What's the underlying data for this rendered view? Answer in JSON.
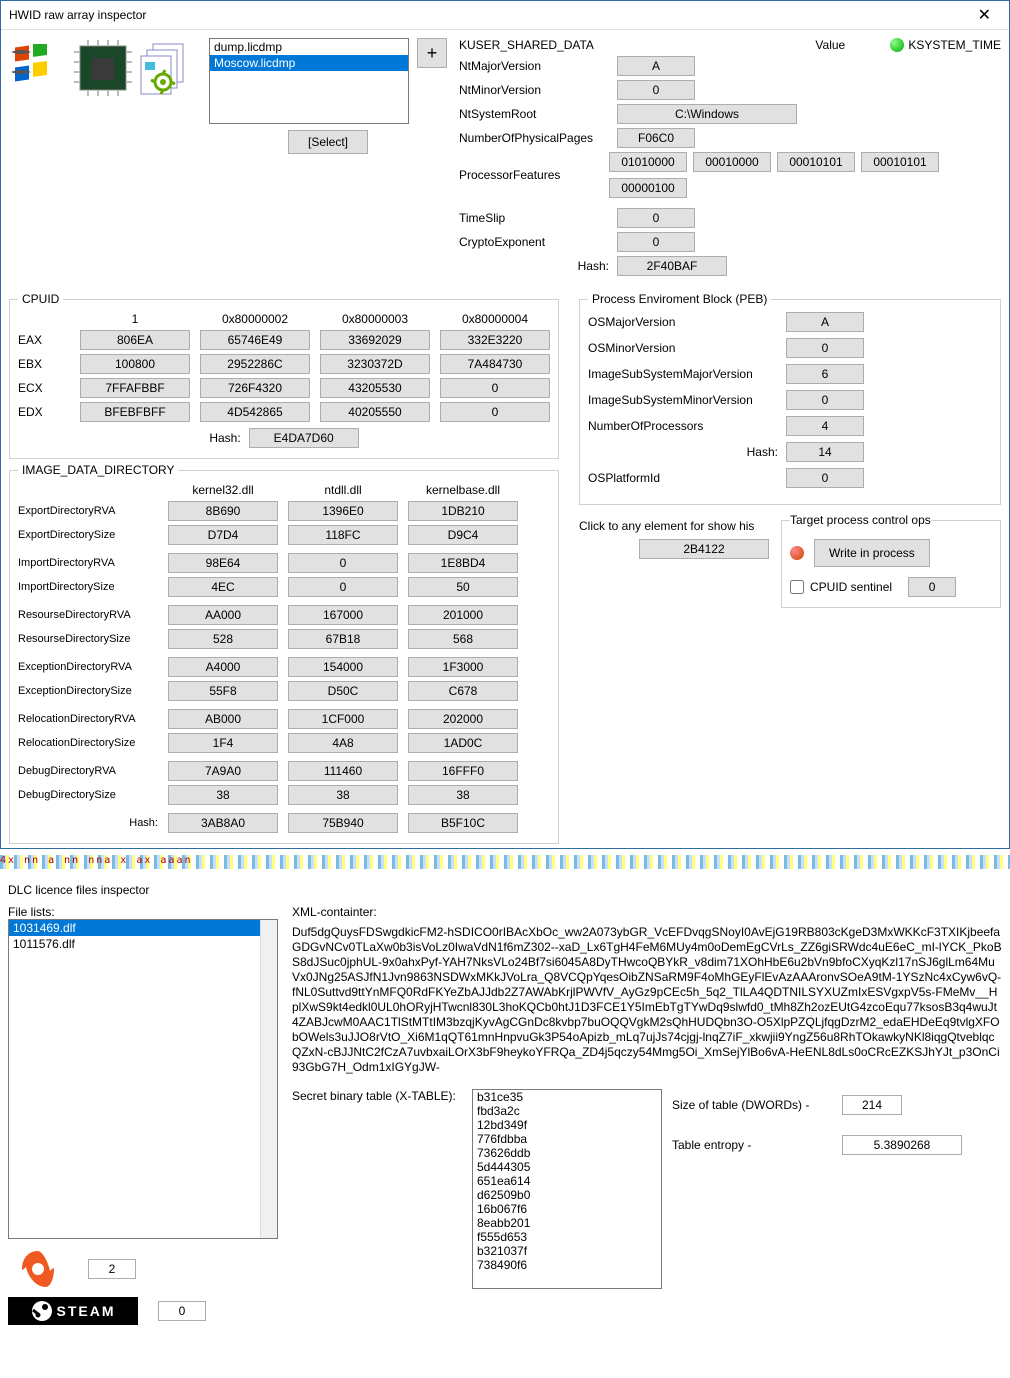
{
  "window1": {
    "title": "HWID raw array inspector",
    "filelist": [
      "dump.licdmp",
      "Moscow.licdmp"
    ],
    "selected_file_idx": 1,
    "plus_label": "+",
    "select_label": "[Select]",
    "ksd": {
      "header": "KUSER_SHARED_DATA",
      "value_header": "Value",
      "systime_label": "KSYSTEM_TIME",
      "rows": {
        "NtMajorVersion": "A",
        "NtMinorVersion": "0",
        "NtSystemRoot": "C:\\Windows",
        "NumberOfPhysicalPages": "F06C0"
      },
      "proc_features_label": "ProcessorFeatures",
      "proc_features": [
        "01010000",
        "00010000",
        "00010101",
        "00010101",
        "00000100"
      ],
      "time_slip_label": "TimeSlip",
      "time_slip": "0",
      "crypto_label": "CryptoExponent",
      "crypto": "0",
      "hash_label": "Hash:",
      "hash": "2F40BAF"
    }
  },
  "cpuid": {
    "legend": "CPUID",
    "cols": [
      "1",
      "0x80000002",
      "0x80000003",
      "0x80000004"
    ],
    "rows": [
      "EAX",
      "EBX",
      "ECX",
      "EDX"
    ],
    "vals": [
      [
        "806EA",
        "65746E49",
        "33692029",
        "332E3220"
      ],
      [
        "100800",
        "2952286C",
        "3230372D",
        "7A484730"
      ],
      [
        "7FFAFBBF",
        "726F4320",
        "43205530",
        "0"
      ],
      [
        "BFEBFBFF",
        "4D542865",
        "40205550",
        "0"
      ]
    ],
    "hash_label": "Hash:",
    "hash": "E4DA7D60"
  },
  "idd": {
    "legend": "IMAGE_DATA_DIRECTORY",
    "cols": [
      "kernel32.dll",
      "ntdll.dll",
      "kernelbase.dll"
    ],
    "rows": [
      "ExportDirectoryRVA",
      "ExportDirectorySize",
      "ImportDirectoryRVA",
      "ImportDirectorySize",
      "ResourseDirectoryRVA",
      "ResourseDirectorySize",
      "ExceptionDirectoryRVA",
      "ExceptionDirectorySize",
      "RelocationDirectoryRVA",
      "RelocationDirectorySize",
      "DebugDirectoryRVA",
      "DebugDirectorySize"
    ],
    "vals": [
      [
        "8B690",
        "1396E0",
        "1DB210"
      ],
      [
        "D7D4",
        "118FC",
        "D9C4"
      ],
      [
        "98E64",
        "0",
        "1E8BD4"
      ],
      [
        "4EC",
        "0",
        "50"
      ],
      [
        "AA000",
        "167000",
        "201000"
      ],
      [
        "528",
        "67B18",
        "568"
      ],
      [
        "A4000",
        "154000",
        "1F3000"
      ],
      [
        "55F8",
        "D50C",
        "C678"
      ],
      [
        "AB000",
        "1CF000",
        "202000"
      ],
      [
        "1F4",
        "4A8",
        "1AD0C"
      ],
      [
        "7A9A0",
        "111460",
        "16FFF0"
      ],
      [
        "38",
        "38",
        "38"
      ]
    ],
    "hash_label": "Hash:",
    "hash": [
      "3AB8A0",
      "75B940",
      "B5F10C"
    ]
  },
  "peb": {
    "legend": "Process Enviroment Block (PEB)",
    "rows": {
      "OSMajorVersion": "A",
      "OSMinorVersion": "0",
      "ImageSubSystemMajorVersion": "6",
      "ImageSubSystemMinorVersion": "0",
      "NumberOfProcessors": "4"
    },
    "hash_label": "Hash:",
    "hash": "14",
    "platform_label": "OSPlatformId",
    "platform": "0"
  },
  "click_label": "Click to any element for show his",
  "click_value": "2B4122",
  "tpcops": {
    "legend": "Target process control ops",
    "write_label": "Write in process",
    "sentinel_label": "CPUID sentinel",
    "sentinel_value": "0"
  },
  "garbage": "4x nn a   nn nna x     ax aaan",
  "window2": {
    "title": "DLC licence files inspector",
    "file_list_label": "File lists:",
    "files": [
      "1011576.dlf",
      "1031469.dlf"
    ],
    "selected_file_idx": 1,
    "origin_count": "2",
    "steam_text": "STEAM",
    "steam_count": "0",
    "xml_label": "XML-containter:",
    "xml": "Duf5dgQuysFDSwgdkicFM2-hSDICO0rIBAcXbOc_ww2A073ybGR_VcEFDvqgSNoyI0AvEjG19RB803cKgeD3MxWKKcF3TXIKjbeefaGDGvNCv0TLaXw0b3isVoLz0IwaVdN1f6mZ302--xaD_Lx6TgH4FeM6MUy4m0oDemEgCVrLs_ZZ6giSRWdc4uE6eC_mI-lYCK_PkoBS8dJSuc0jphUL-9x0ahxPyf-YAH7NksVLo24Bf7si6045A8DyTHwcoQBYkR_v8dim71XOhHbE6u2bVn9bfoCXyqKzl17nSJ6glLm64MuVx0JNg25ASJfN1Jvn9863NSDWxMKkJVoLra_Q8VCQpYqesOibZNSaRM9F4oMhGEyFlEvAzAAAronvSOeA9tM-1YSzNc4xCyw6vQ-fNL0Suttvd9ttYnMFQ0RdFKYeZbAJJdb2Z7AWAbKrjlPWVfV_AyGz9pCEc5h_5q2_TlLA4QDTNILSYXUZmIxESVgxpV5s-FMeMv__HplXwS9kt4edkl0UL0hORyjHTwcnl830L3hoKQCb0htJ1D3FCE1Y5ImEbTgTYwDq9slwfd0_tMh8Zh2ozEUtG4zcoEqu77ksosB3q4wuJt4ZABJcwM0AAC1TlStMTtIM3bzqjKyvAgCGnDc8kvbp7buOQQVgkM2sQhHUDQbn3O-O5XlpPZQLjfqgDzrM2_edaEHDeEq9tvlgXFObOWels3uJJO8rVtO_Xi6M1qQT61mnHnpvuGk3P54oApizb_mLq7ujJs74cjgj-lnqZ7iF_xkwjii9YngZ56u8RhTOkawkyNKl8iqgQtveblqcQZxN-cBJJNtC2fCzA7uvbxaiLOrX3bF9heykoYFRQa_ZD4j5qczy54Mmg5Oi_XmSejYlBo6vA-HeENL8dLs0oCRcEZKSJhYJt_p3OnCi93GbG7H_Odm1xIGYgJW-",
    "xtable_label": "Secret binary table (X-TABLE):",
    "xtable": [
      "b31ce35",
      "fbd3a2c",
      "12bd349f",
      "776fdbba",
      "73626ddb",
      "5d444305",
      "651ea614",
      "d62509b0",
      "16b067f6",
      "8eabb201",
      "f555d653",
      "b321037f",
      "738490f6"
    ],
    "size_label": "Size of table (DWORDs) -",
    "size_value": "214",
    "entropy_label": "Table entropy -",
    "entropy_value": "5.3890268"
  }
}
